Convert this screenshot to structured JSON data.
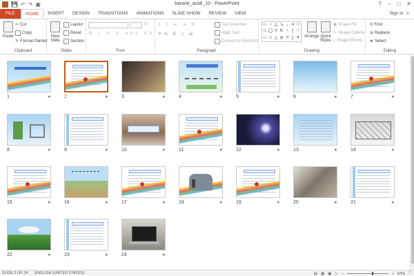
{
  "window": {
    "title": "barane_acidi_10 - PowerPoint",
    "controls": [
      "?",
      "–",
      "□",
      "✕"
    ]
  },
  "tabs": {
    "items": [
      "FILE",
      "HOME",
      "INSERT",
      "DESIGN",
      "TRANSITIONS",
      "ANIMATIONS",
      "SLIDE SHOW",
      "REVIEW",
      "VIEW"
    ],
    "active": "HOME",
    "sign_in": "Sign in"
  },
  "ribbon": {
    "clipboard": {
      "label": "Clipboard",
      "paste": "Paste",
      "cut": "Cut",
      "copy": "Copy",
      "format_painter": "Format Painter"
    },
    "slides": {
      "label": "Slides",
      "new_slide": "New Slide",
      "layout": "Layout",
      "reset": "Reset",
      "section": "Section"
    },
    "font": {
      "label": "Font"
    },
    "paragraph": {
      "label": "Paragraph",
      "text_direction": "Text Direction",
      "align_text": "Align Text",
      "convert_smartart": "Convert to SmartArt"
    },
    "drawing": {
      "label": "Drawing",
      "arrange": "Arrange",
      "quick_styles": "Quick Styles",
      "shape_fill": "Shape Fill",
      "shape_outline": "Shape Outline",
      "shape_effects": "Shape Effects"
    },
    "editing": {
      "label": "Editing",
      "find": "Find",
      "replace": "Replace",
      "select": "Select"
    }
  },
  "slides": [
    {
      "number": "1",
      "style": "rainbow-title"
    },
    {
      "number": "2",
      "style": "rainbow-text",
      "selected": true
    },
    {
      "number": "3",
      "style": "photo-dark"
    },
    {
      "number": "4",
      "style": "diagram-sky"
    },
    {
      "number": "5",
      "style": "text-box"
    },
    {
      "number": "6",
      "style": "sky"
    },
    {
      "number": "7",
      "style": "rainbow-text"
    },
    {
      "number": "8",
      "style": "sky-diagram"
    },
    {
      "number": "9",
      "style": "text-box"
    },
    {
      "number": "10",
      "style": "photo-ruins"
    },
    {
      "number": "11",
      "style": "rainbow-text"
    },
    {
      "number": "12",
      "style": "photo-lightning"
    },
    {
      "number": "13",
      "style": "sky-text"
    },
    {
      "number": "14",
      "style": "diagram-gray"
    },
    {
      "number": "15",
      "style": "rainbow-text"
    },
    {
      "number": "16",
      "style": "diagram-land"
    },
    {
      "number": "17",
      "style": "rainbow-text"
    },
    {
      "number": "18",
      "style": "diagram-factory"
    },
    {
      "number": "19",
      "style": "rainbow-text"
    },
    {
      "number": "20",
      "style": "photo-statue"
    },
    {
      "number": "21",
      "style": "text-box"
    },
    {
      "number": "22",
      "style": "diagram-green"
    },
    {
      "number": "23",
      "style": "text-box"
    },
    {
      "number": "24",
      "style": "photo-laptop"
    }
  ],
  "statusbar": {
    "slide_info": "SLIDE 2 OF 24",
    "language": "ENGLISH (UNITED STATES)",
    "zoom": "63%"
  },
  "colors": {
    "accent": "#d24726",
    "selected": "#c55a11"
  }
}
